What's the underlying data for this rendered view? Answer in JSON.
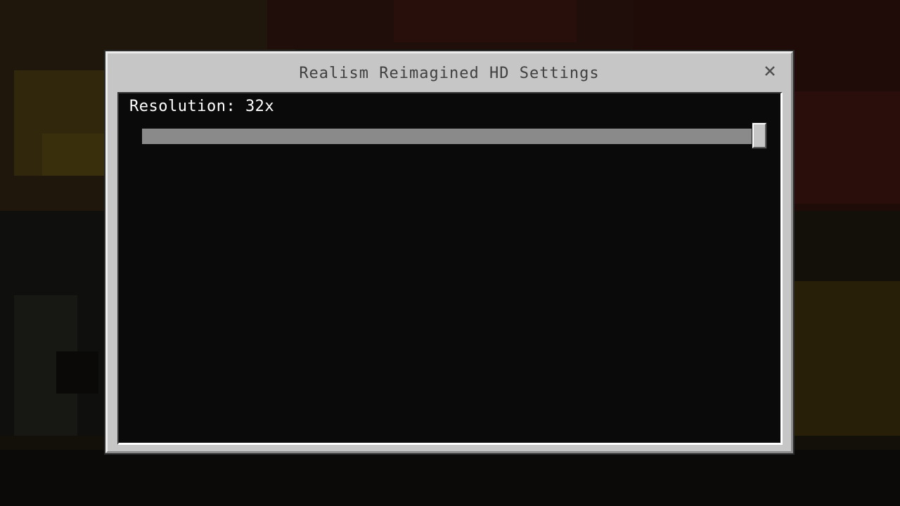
{
  "dialog": {
    "title": "Realism Reimagined HD Settings",
    "close_icon": "close-icon"
  },
  "settings": [
    {
      "label": "Resolution: 32x",
      "control": "slider",
      "value_fraction": 1.0
    }
  ],
  "colors": {
    "dialog_background": "#c6c6c6",
    "panel_background": "#0a0a0a",
    "title_text": "#404040",
    "label_text": "#ffffff",
    "slider_track": "#838383",
    "slider_thumb": "#c6c6c6"
  }
}
